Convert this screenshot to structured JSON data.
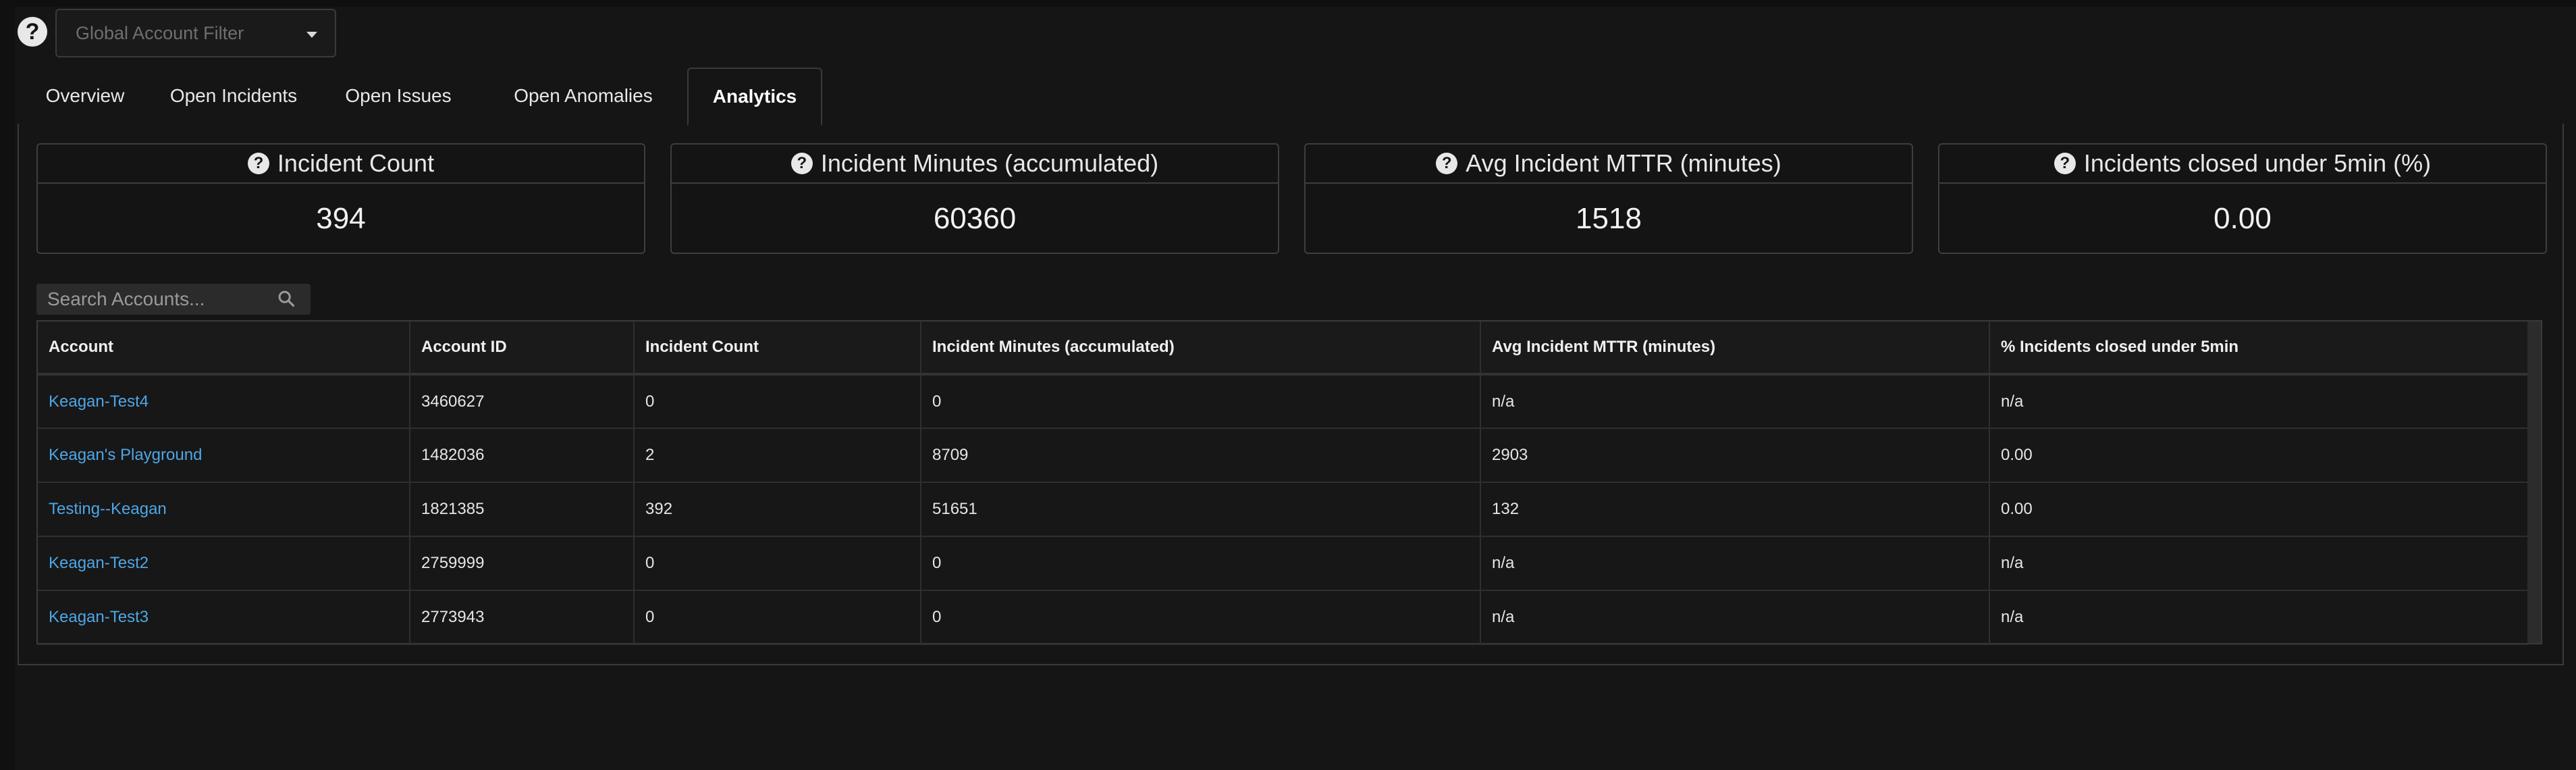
{
  "filter": {
    "placeholder": "Global Account Filter"
  },
  "tabs": [
    {
      "label": "Overview"
    },
    {
      "label": "Open Incidents"
    },
    {
      "label": "Open Issues"
    },
    {
      "label": "Open Anomalies"
    },
    {
      "label": "Analytics",
      "active": true
    }
  ],
  "metrics": [
    {
      "title": "Incident Count",
      "value": "394"
    },
    {
      "title": "Incident Minutes (accumulated)",
      "value": "60360"
    },
    {
      "title": "Avg Incident MTTR (minutes)",
      "value": "1518"
    },
    {
      "title": "Incidents closed under 5min (%)",
      "value": "0.00"
    }
  ],
  "search": {
    "placeholder": "Search Accounts..."
  },
  "table": {
    "columns": [
      "Account",
      "Account ID",
      "Incident Count",
      "Incident Minutes (accumulated)",
      "Avg Incident MTTR (minutes)",
      "% Incidents closed under 5min"
    ],
    "rows": [
      {
        "account": "Keagan-Test4",
        "account_id": "3460627",
        "incident_count": "0",
        "incident_minutes": "0",
        "mttr": "n/a",
        "pct_under_5": "n/a"
      },
      {
        "account": "Keagan's Playground",
        "account_id": "1482036",
        "incident_count": "2",
        "incident_minutes": "8709",
        "mttr": "2903",
        "pct_under_5": "0.00"
      },
      {
        "account": "Testing--Keagan",
        "account_id": "1821385",
        "incident_count": "392",
        "incident_minutes": "51651",
        "mttr": "132",
        "pct_under_5": "0.00"
      },
      {
        "account": "Keagan-Test2",
        "account_id": "2759999",
        "incident_count": "0",
        "incident_minutes": "0",
        "mttr": "n/a",
        "pct_under_5": "n/a"
      },
      {
        "account": "Keagan-Test3",
        "account_id": "2773943",
        "incident_count": "0",
        "incident_minutes": "0",
        "mttr": "n/a",
        "pct_under_5": "n/a"
      }
    ]
  },
  "colors": {
    "background": "#151515",
    "link": "#4ea6e6",
    "border": "#3a3a3a"
  },
  "icons": {
    "help": "help-circle-icon",
    "dropdown": "chevron-down-icon",
    "search": "search-icon"
  }
}
